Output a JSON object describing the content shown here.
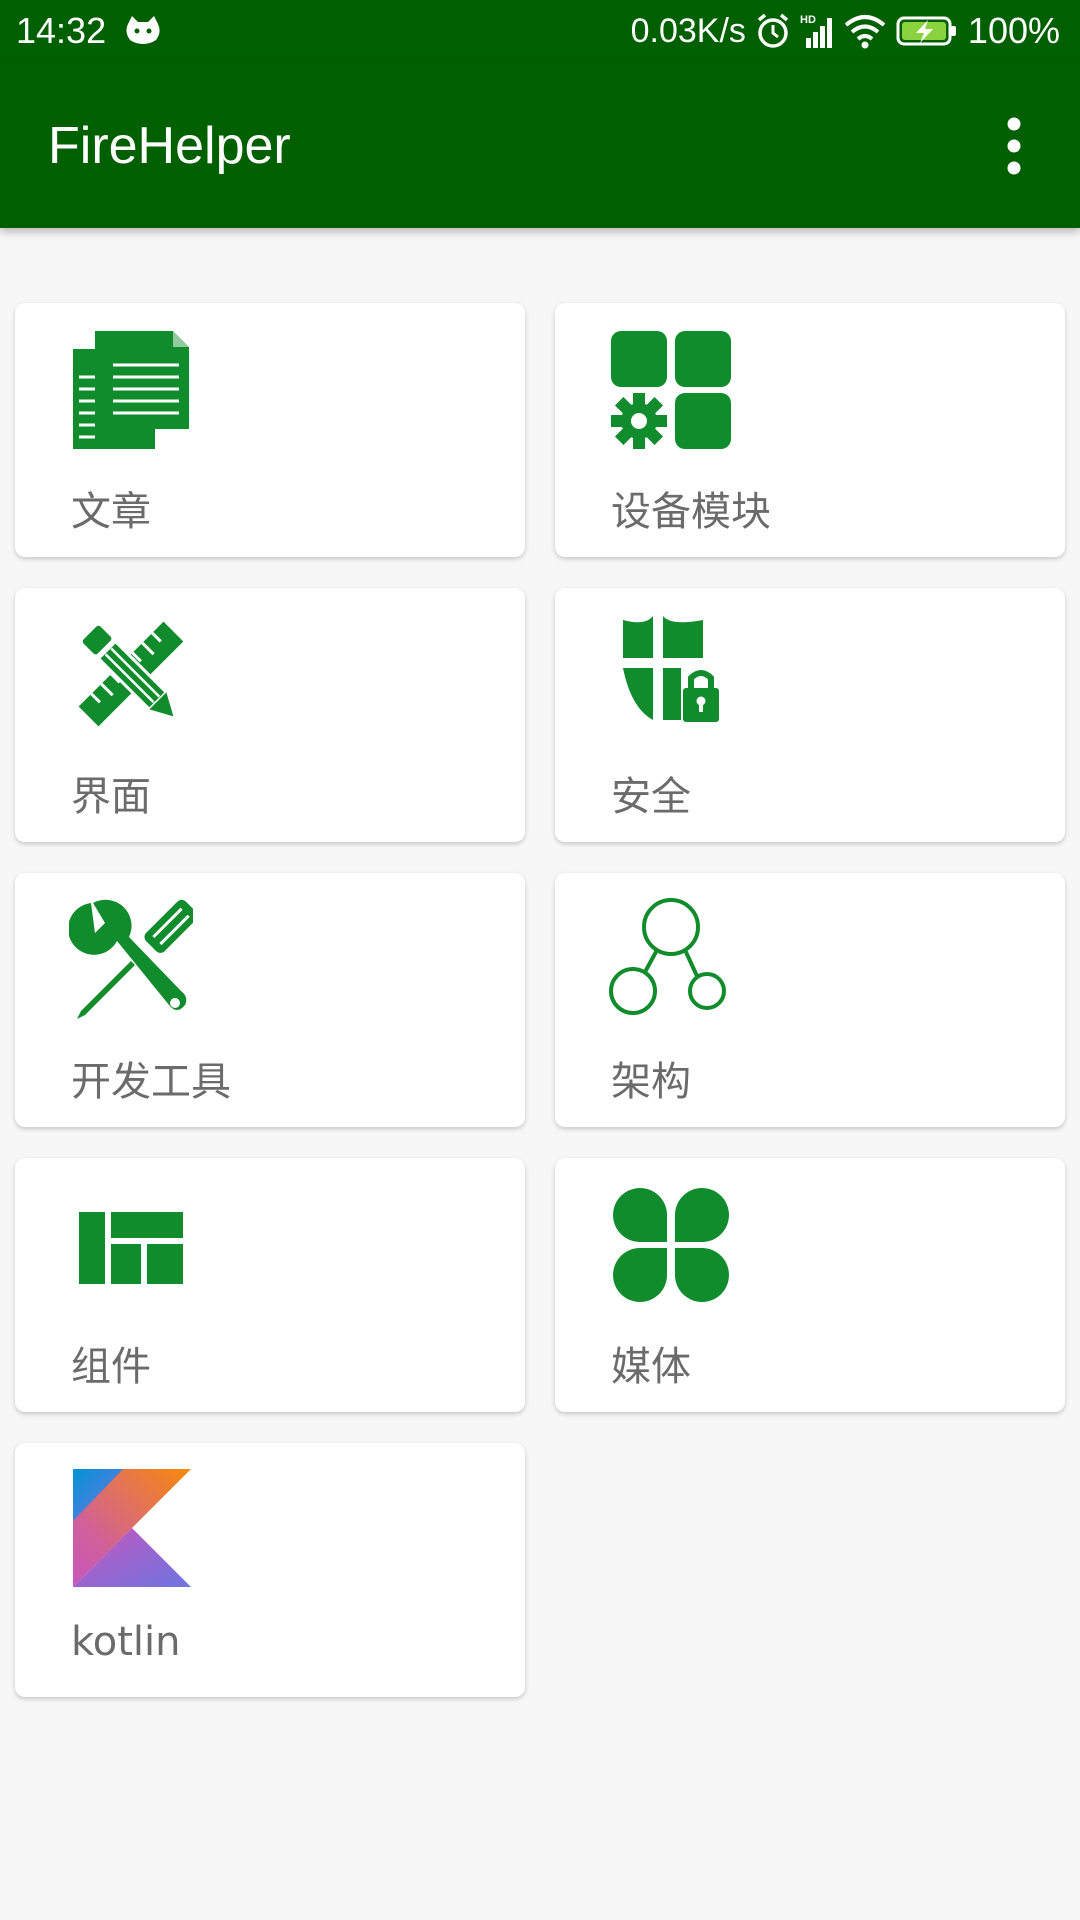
{
  "status_bar": {
    "time": "14:32",
    "network_speed": "0.03K/s",
    "battery": "100%"
  },
  "app": {
    "title": "FireHelper"
  },
  "cards": [
    {
      "label": "文章",
      "icon": "document-icon"
    },
    {
      "label": "设备模块",
      "icon": "device-module-icon"
    },
    {
      "label": "界面",
      "icon": "pencil-ruler-icon"
    },
    {
      "label": "安全",
      "icon": "shield-lock-icon"
    },
    {
      "label": "开发工具",
      "icon": "dev-tools-icon"
    },
    {
      "label": "架构",
      "icon": "architecture-nodes-icon"
    },
    {
      "label": "组件",
      "icon": "component-layout-icon"
    },
    {
      "label": "媒体",
      "icon": "media-clover-icon"
    },
    {
      "label": "kotlin",
      "icon": "kotlin-logo-icon"
    }
  ],
  "colors": {
    "bar": "#006000",
    "accent": "#118c2d",
    "label": "#6b6b6b",
    "background": "#f7f7f7"
  }
}
